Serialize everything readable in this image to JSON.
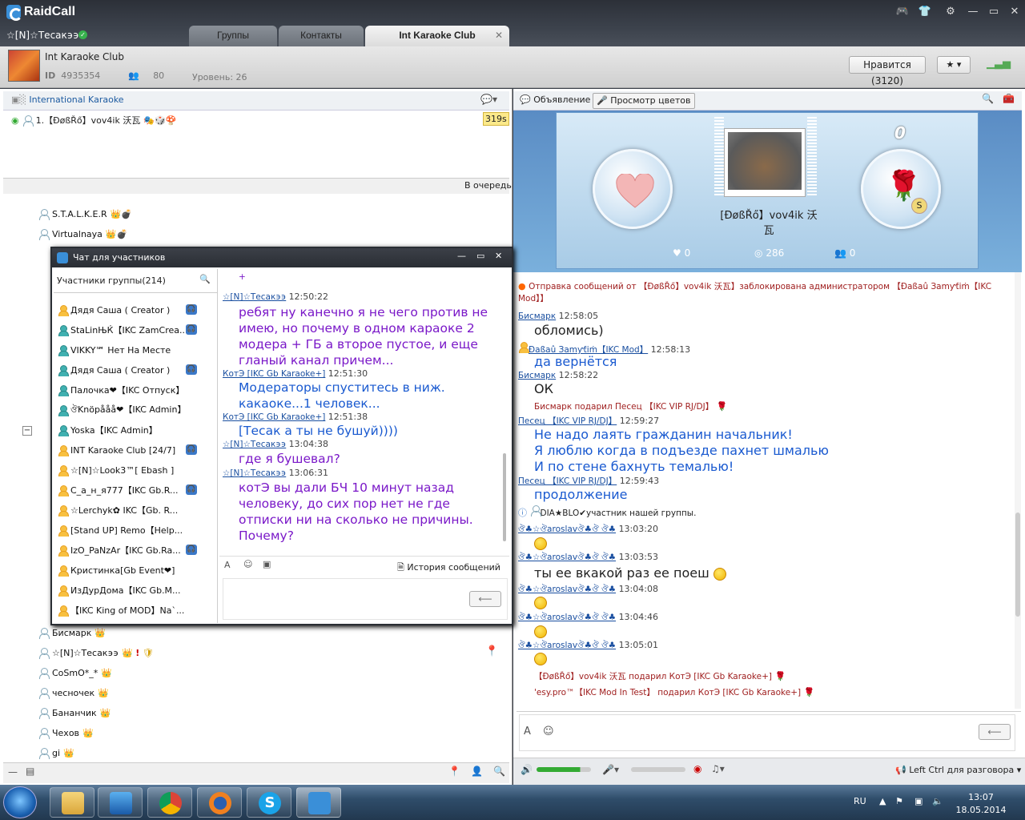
{
  "app": {
    "name": "RaidCall",
    "username": "☆[N]☆Тесак϶϶"
  },
  "tabs": [
    "Группы",
    "Контакты",
    "Int Karaoke Club"
  ],
  "channel": {
    "title": "Int Karaoke Club",
    "id_label": "ID",
    "id": "4935354",
    "members": "80",
    "level": "Уровень: 26",
    "like_label": "Нравится (3120)"
  },
  "left_head": {
    "subchannel": "International Karaoke",
    "queue_entry": "1.【ÐøßŘő】vov4ik 沃瓦",
    "queue_time": "319s",
    "queue_button": "В очередь"
  },
  "users": [
    "S.T.A.L.K.E.R",
    "Virtualnaya",
    "Бисмарк",
    "☆[N]☆Тесак϶϶",
    "CoSmO*_*",
    "чесночек",
    "Бананчик",
    "Чехов",
    "gi"
  ],
  "popup": {
    "title": "Чат для участников",
    "members_label": "Участники группы(214)",
    "members": [
      "Дядя Саша ( Creator )",
      "StaLinЊЌ【IKC ZamCrea...",
      "VIKKY℠ Нет На Месте",
      "Дядя  Саша ( Creator )",
      "Палочка❤【IKC Отпуск】",
      "ঔKnöpååå❤【IKC Admin】",
      "Yoѕka【IKC Admin】",
      "INT Karaoke Club [24/7]",
      "☆[N]☆Look3™[ Ebash ]",
      "С_а_н_я777【IKC Gb.R...",
      "☆Lerchyk✿ IKC【Gb. R...",
      "[Stand UP] Remo【Help...",
      "IzO_PaNzAr【IKC Gb.Ra...",
      "Кристинка[Gb Event❤]",
      "ИзДурДома【IKC Gb.M...",
      "【IKC King of MOD】Na`..."
    ],
    "messages": [
      {
        "name": "☆[N]☆Тесак϶϶",
        "time": "12:50:22",
        "text": [
          "ребят ну канечно я не чего против не",
          "имею, но почему в одном караоке 2",
          "модера + ГБ а второе пустое, и еще",
          "гланый канал причем..."
        ]
      },
      {
        "name": "КотЭ [IKC Gb Karaoke+]",
        "time": "12:51:30",
        "text": [
          "Модераторы спуститесь в ниж.",
          "какаоке...1 человек..."
        ]
      },
      {
        "name": "КотЭ [IKC Gb Karaoke+]",
        "time": "12:51:38",
        "text": [
          "[Тесак а ты не бушуй))))"
        ]
      },
      {
        "name": "☆[N]☆Тесак϶϶",
        "time": "13:04:38",
        "text": [
          "где я бушевал?"
        ]
      },
      {
        "name": "☆[N]☆Тесак϶϶",
        "time": "13:06:31",
        "text": [
          "котЭ вы дали БЧ 10 минут назад",
          "человеку, до сих пор нет не где",
          "отписки ни на сколько не причины.",
          "Почему?"
        ]
      }
    ],
    "history_label": "История сообщений"
  },
  "right_head": {
    "announce": "Объявление",
    "colors": "Просмотр цветов"
  },
  "stage": {
    "performer": "[ÐøßŘő】vov4ik 沃瓦",
    "score": "0",
    "hearts": "0",
    "views": "286",
    "people": "0"
  },
  "chat": {
    "sys": "Отправка сообщений от 【ÐøßŘő】vov4ik 沃瓦】заблокирована администратором 【Ðaßaû Зamƴƭiṁ【IKC",
    "sys2": "Mod】】",
    "lines": [
      {
        "name": "Бисмарк",
        "time": "12:58:05",
        "text": "обломись)"
      },
      {
        "name": "Ðaßaû Зamƴƭiṁ【IKC Mod】",
        "time": "12:58:13",
        "text": "да вернётся"
      },
      {
        "name": "Бисмарк",
        "time": "12:58:22",
        "text": "ОК"
      },
      {
        "name": "Песец 【IKC VIP RJ/DJ】",
        "time": "12:59:27",
        "text1": "Не надо лаять гражданин начальник!",
        "text2": "Я люблю когда в подъезде пахнет шмалью",
        "text3": "И по стене бахнуть темалью!"
      },
      {
        "name": "Песец 【IKC VIP RJ/DJ】",
        "time": "12:59:43",
        "text": "продолжение"
      },
      {
        "name": "ঔ♣☆ঔaroslavঔ♣ঔ ঔ♣",
        "time": "13:03:20"
      },
      {
        "name": "ঔ♣☆ঔaroslavঔ♣ঔ ঔ♣",
        "time": "13:03:53",
        "text": "ты ее вкакой раз ее поеш"
      },
      {
        "name": "ঔ♣☆ঔaroslavঔ♣ঔ ঔ♣",
        "time": "13:04:08"
      },
      {
        "name": "ঔ♣☆ঔaroslavঔ♣ঔ ঔ♣",
        "time": "13:04:46"
      },
      {
        "name": "ঔ♣☆ঔaroslavঔ♣ঔ ঔ♣",
        "time": "13:05:01"
      }
    ],
    "gift1": "Бисмарк подарил Песец 【IKC VIP RJ/DJ】",
    "info": "DIA★BLO✔участник нашей группы.",
    "gift2": "【ÐøßŘő】vov4ik 沃瓦 подарил КотЭ [IKC Gb Karaoke+]",
    "gift3": "'esy.pro™【IKC Mod In Test】 подарил КотЭ [IKC Gb Karaoke+]"
  },
  "audio": {
    "ptt": "Left Ctrl для разговора"
  },
  "taskbar": {
    "lang": "RU",
    "time": "13:07",
    "date": "18.05.2014"
  }
}
